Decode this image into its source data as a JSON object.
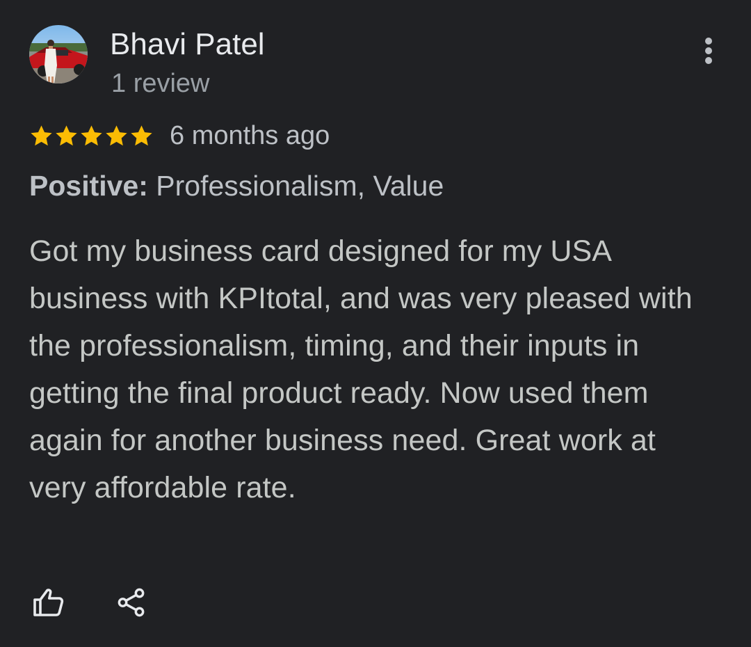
{
  "review": {
    "author": "Bhavi Patel",
    "author_review_count": "1 review",
    "rating": 5,
    "rating_max": 5,
    "time_ago": "6 months ago",
    "highlights_label": "Positive:",
    "highlights_value": " Professionalism, Value",
    "text": "Got my business card designed for my USA business with KPItotal, and was very pleased with the professionalism, timing, and their inputs in getting the final product ready. Now used them again for another business need. Great work at very affordable rate."
  },
  "icons": {
    "avatar": "user-avatar-photo",
    "more": "more-vert-icon",
    "star": "star-icon",
    "like": "thumb-up-outline-icon",
    "share": "share-icon"
  },
  "colors": {
    "background": "#202124",
    "star": "#fbbc04",
    "primary_text": "#e8eaed",
    "secondary_text": "#9aa0a6"
  }
}
